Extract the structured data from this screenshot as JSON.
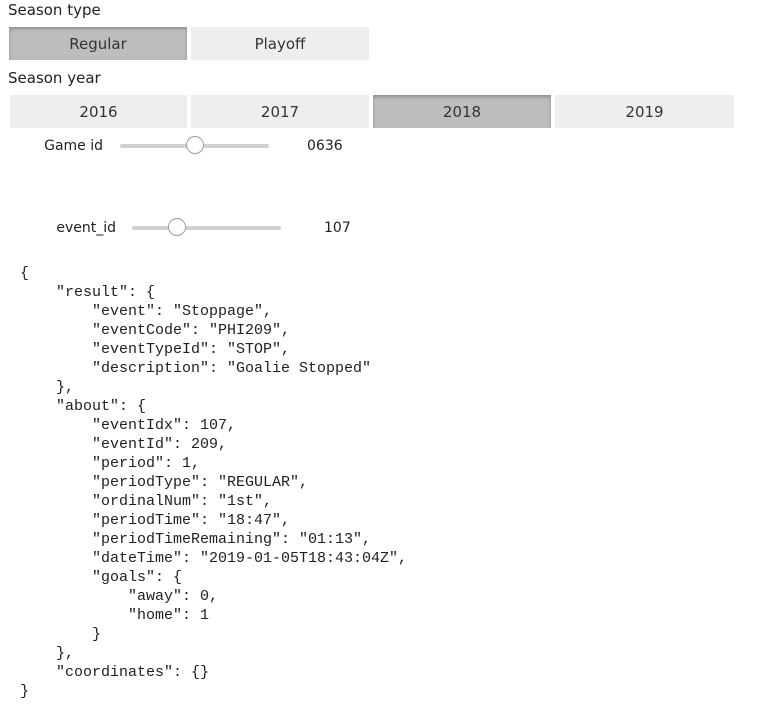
{
  "season_type": {
    "label": "Season type",
    "options": [
      {
        "label": "Regular",
        "selected": true
      },
      {
        "label": "Playoff",
        "selected": false
      }
    ]
  },
  "season_year": {
    "label": "Season year",
    "options": [
      {
        "label": "2016",
        "selected": false
      },
      {
        "label": "2017",
        "selected": false
      },
      {
        "label": "2018",
        "selected": true
      },
      {
        "label": "2019",
        "selected": false
      }
    ]
  },
  "game_id": {
    "label": "Game id",
    "value": "0636",
    "fraction": 0.5
  },
  "event_id": {
    "label": "event_id",
    "value": "107",
    "fraction": 0.3
  },
  "output": {
    "json_text": "{\n    \"result\": {\n        \"event\": \"Stoppage\",\n        \"eventCode\": \"PHI209\",\n        \"eventTypeId\": \"STOP\",\n        \"description\": \"Goalie Stopped\"\n    },\n    \"about\": {\n        \"eventIdx\": 107,\n        \"eventId\": 209,\n        \"period\": 1,\n        \"periodType\": \"REGULAR\",\n        \"ordinalNum\": \"1st\",\n        \"periodTime\": \"18:47\",\n        \"periodTimeRemaining\": \"01:13\",\n        \"dateTime\": \"2019-01-05T18:43:04Z\",\n        \"goals\": {\n            \"away\": 0,\n            \"home\": 1\n        }\n    },\n    \"coordinates\": {}\n}"
  }
}
